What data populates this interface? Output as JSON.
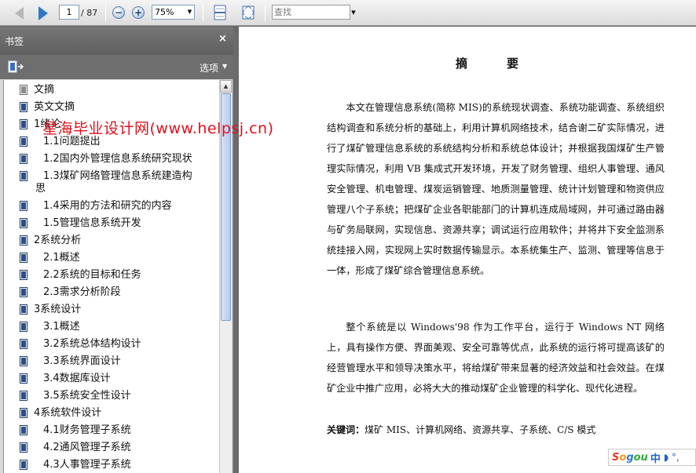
{
  "toolbar": {
    "page_current": "1",
    "page_total": "/ 87",
    "zoom": "75%",
    "search_placeholder": "查找"
  },
  "panel": {
    "title": "书签",
    "close": "×",
    "options": "选项",
    "bookmarks": [
      {
        "label": "文摘",
        "level": 0,
        "icon": "gray"
      },
      {
        "label": "英文文摘",
        "level": 0
      },
      {
        "label": "1绪论",
        "level": 0
      },
      {
        "label": "1.1问题提出",
        "level": 1
      },
      {
        "label": "1.2国内外管理信息系统研究现状",
        "level": 1
      },
      {
        "label": "1.3煤矿网络管理信息系统建造构",
        "label2": "思",
        "level": 1
      },
      {
        "label": "1.4采用的方法和研究的内容",
        "level": 1
      },
      {
        "label": "1.5管理信息系统开发",
        "level": 1
      },
      {
        "label": "2系统分析",
        "level": 0
      },
      {
        "label": "2.1概述",
        "level": 1
      },
      {
        "label": "2.2系统的目标和任务",
        "level": 1
      },
      {
        "label": "2.3需求分析阶段",
        "level": 1
      },
      {
        "label": "3系统设计",
        "level": 0
      },
      {
        "label": "3.1概述",
        "level": 1
      },
      {
        "label": "3.2系统总体结构设计",
        "level": 1
      },
      {
        "label": "3.3系统界面设计",
        "level": 1
      },
      {
        "label": "3.4数据库设计",
        "level": 1
      },
      {
        "label": "3.5系统安全性设计",
        "level": 1
      },
      {
        "label": "4系统软件设计",
        "level": 0
      },
      {
        "label": "4.1财务管理子系统",
        "level": 1
      },
      {
        "label": "4.2通风管理子系统",
        "level": 1
      },
      {
        "label": "4.3人事管理子系统",
        "level": 1
      }
    ]
  },
  "watermark": "星海毕业设计网(www.helpsj.cn)",
  "document": {
    "title": "摘要",
    "paragraph1": "本文在管理信息系统(简称 MIS)的系统现状调查、系统功能调查、系统组织结构调查和系统分析的基础上，利用计算机网络技术，结合谢二矿实际情况，进行了煤矿管理信息系统的系统结构分析和系统总体设计；并根据我国煤矿生产管理实际情况，利用 VB 集成式开发环境，开发了财务管理、组织人事管理、通风安全管理、机电管理、煤炭运销管理、地质测量管理、统计计划管理和物资供应管理八个子系统；把煤矿企业各职能部门的计算机连成局域网，并可通过路由器与矿务局联网，实现信息、资源共享；调试运行应用软件；并将井下安全监测系统挂接入网，实现网上实时数据传输显示。本系统集生产、监测、管理等信息于一体，形成了煤矿综合管理信息系统。",
    "paragraph2": "整个系统是以 Windows'98 作为工作平台，运行于 Windows NT 网络上，具有操作方便、界面美观、安全可靠等优点，此系统的运行将可提高该矿的经营管理水平和领导决策水平，将给煤矿带来显著的经济效益和社会效益。在煤矿企业中推广应用，必将大大的推动煤矿企业管理的科学化、现代化进程。",
    "keywords_label": "关键词：",
    "keywords": "煤矿 MIS、计算机网络、资源共享、子系统、C/S 模式"
  },
  "ime": {
    "brand_s": "S",
    "brand_o": "o",
    "brand_g": "g",
    "brand_ou": "ou",
    "mode": "中",
    "symbols": "◗ °,"
  }
}
